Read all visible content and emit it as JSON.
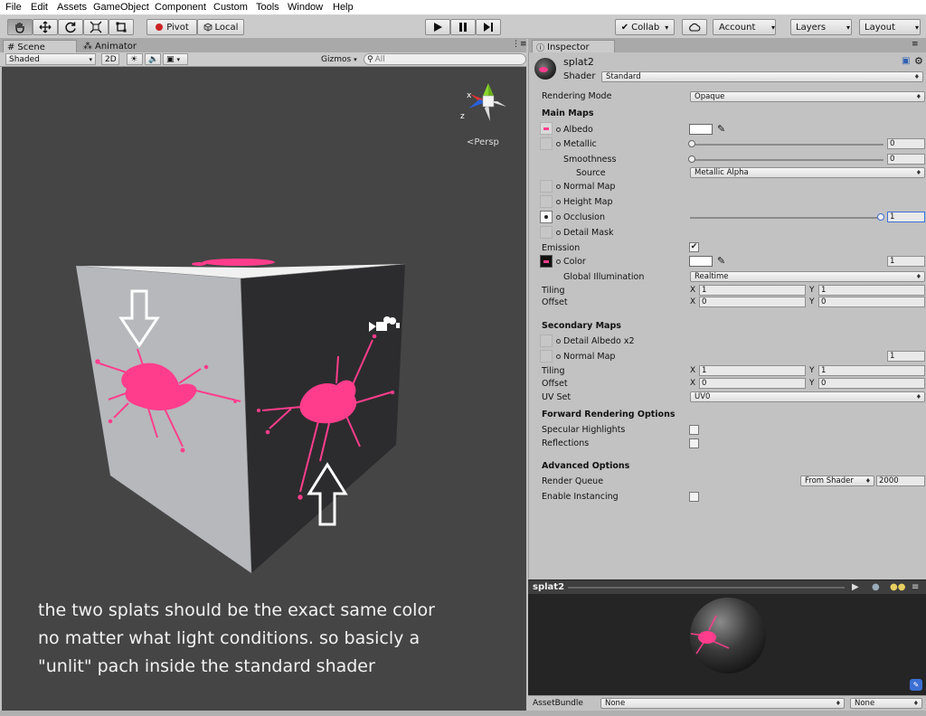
{
  "menu": [
    "File",
    "Edit",
    "Assets",
    "GameObject",
    "Component",
    "Custom",
    "Tools",
    "Window",
    "Help"
  ],
  "toolbar": {
    "pivot_label": "Pivot",
    "local_label": "Local",
    "collab_label": "Collab",
    "account_label": "Account",
    "layers_label": "Layers",
    "layout_label": "Layout"
  },
  "scene": {
    "tab_scene": "Scene",
    "tab_animator": "Animator",
    "shading_mode": "Shaded",
    "mode_2d": "2D",
    "gizmos_label": "Gizmos",
    "search_placeholder": "All",
    "persp_label": "Persp",
    "axis_x": "x",
    "axis_z": "z",
    "caption": [
      "the two splats should be the exact same color",
      "no matter what  light conditions. so basicly a",
      "\"unlit\" pach inside the standard shader"
    ]
  },
  "inspector": {
    "tab_label": "Inspector",
    "material_name": "splat2",
    "shader_label": "Shader",
    "shader_value": "Standard",
    "rendering_mode_label": "Rendering Mode",
    "rendering_mode_value": "Opaque",
    "main_maps": "Main Maps",
    "albedo": "Albedo",
    "metallic": "Metallic",
    "metallic_value": "0",
    "smoothness": "Smoothness",
    "smoothness_value": "0",
    "source": "Source",
    "source_value": "Metallic Alpha",
    "normal_map": "Normal Map",
    "height_map": "Height Map",
    "occlusion": "Occlusion",
    "occlusion_value": "1",
    "detail_mask": "Detail Mask",
    "emission": "Emission",
    "emission_checked": true,
    "color": "Color",
    "color_value": "1",
    "global_illumination": "Global Illumination",
    "gi_value": "Realtime",
    "tiling": "Tiling",
    "offset": "Offset",
    "tiling_x": "1",
    "tiling_y": "1",
    "offset_x": "0",
    "offset_y": "0",
    "x_label": "X",
    "y_label": "Y",
    "secondary_maps": "Secondary Maps",
    "detail_albedo": "Detail Albedo x2",
    "sec_normal_map": "Normal Map",
    "sec_normal_value": "1",
    "sec_tiling_x": "1",
    "sec_tiling_y": "1",
    "sec_offset_x": "0",
    "sec_offset_y": "0",
    "uv_set": "UV Set",
    "uv_set_value": "UV0",
    "forward_rendering": "Forward Rendering Options",
    "specular_highlights": "Specular Highlights",
    "reflections": "Reflections",
    "advanced_options": "Advanced Options",
    "render_queue": "Render Queue",
    "render_queue_mode": "From Shader",
    "render_queue_value": "2000",
    "enable_instancing": "Enable Instancing"
  },
  "preview": {
    "title": "splat2"
  },
  "assetbundle": {
    "label": "AssetBundle",
    "name_value": "None",
    "variant_value": "None"
  },
  "colors": {
    "splat": "#ff3d8c",
    "viewport_bg": "#454545",
    "panel_bg": "#c2c2c2"
  }
}
